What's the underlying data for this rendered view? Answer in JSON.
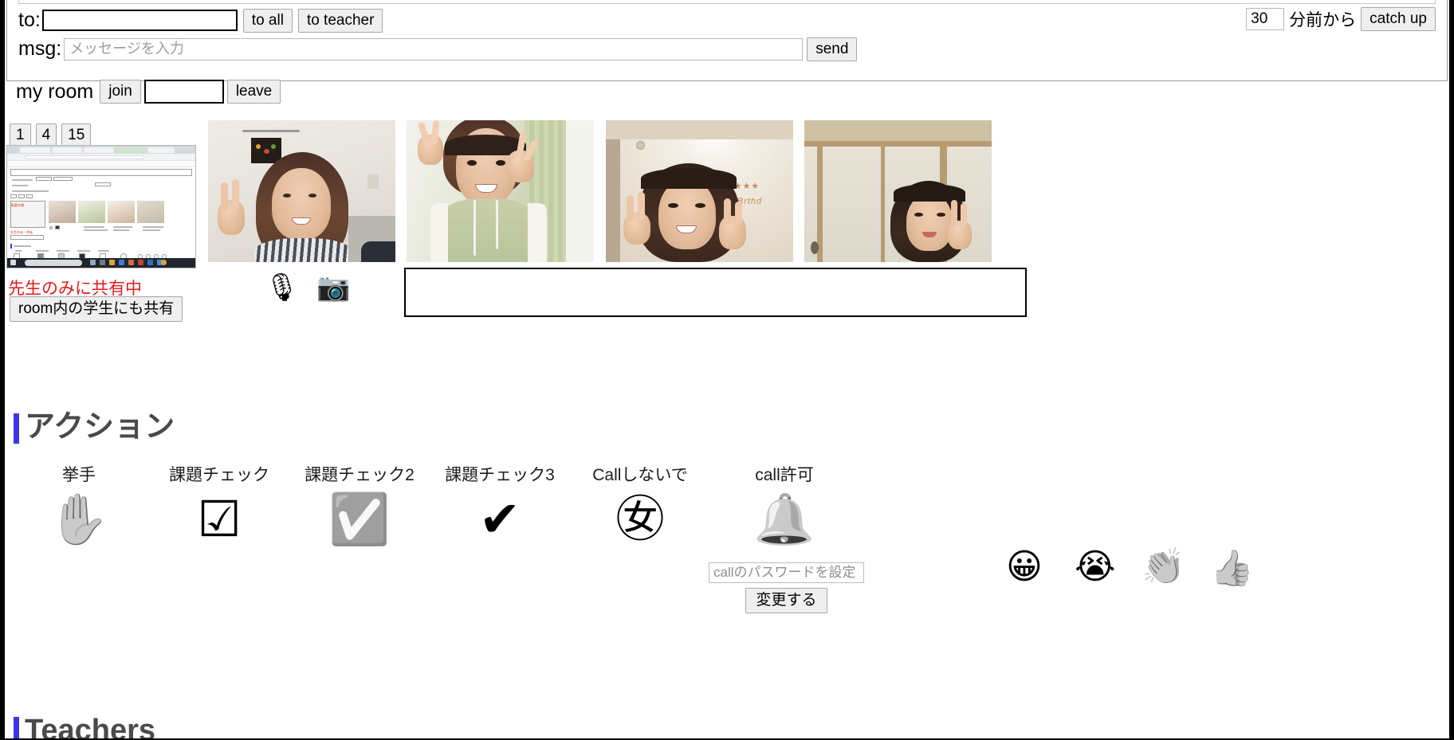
{
  "chat": {
    "history_value": "",
    "to_label": "to:",
    "to_value": "",
    "to_all_button": "to all",
    "to_teacher_button": "to teacher",
    "msg_label": "msg:",
    "msg_value": "",
    "msg_placeholder": "メッセージを入力",
    "send_button": "send",
    "catchup_minutes": "30",
    "catchup_unit_label": "分前から",
    "catchup_button": "catch up"
  },
  "room": {
    "title": "my room",
    "join_button": "join",
    "room_value": "",
    "leave_button": "leave",
    "layout_buttons": [
      "1",
      "4",
      "15"
    ]
  },
  "share": {
    "status_text": "先生のみに共有中",
    "share_button": "room内の学生にも共有",
    "mic_icon": "🎙",
    "camera_icon": "📷"
  },
  "videos": [
    {
      "name": "participant-1"
    },
    {
      "name": "participant-2"
    },
    {
      "name": "participant-3"
    },
    {
      "name": "participant-4"
    }
  ],
  "note_box": {
    "value": ""
  },
  "sections": {
    "action_heading": "アクション",
    "teachers_heading": "Teachers"
  },
  "actions": [
    {
      "label": "挙手",
      "icon": "✋",
      "name": "raise-hand"
    },
    {
      "label": "課題チェック",
      "icon": "☑",
      "name": "task-check-1"
    },
    {
      "label": "課題チェック2",
      "icon": "✅",
      "name": "task-check-2"
    },
    {
      "label": "課題チェック3",
      "icon": "✔",
      "name": "task-check-3"
    },
    {
      "label": "Callしないで",
      "icon": "㊛",
      "name": "do-not-call"
    },
    {
      "label": "call許可",
      "icon": "🔔",
      "name": "allow-call"
    }
  ],
  "reactions": [
    {
      "icon": "😀",
      "name": "smile-reaction"
    },
    {
      "icon": "😭",
      "name": "cry-reaction"
    },
    {
      "icon": "👏",
      "name": "clap-reaction"
    },
    {
      "icon": "👍",
      "name": "thumbs-up-reaction"
    }
  ],
  "call_password": {
    "value": "",
    "placeholder": "callのパスワードを設定",
    "change_button": "変更する"
  },
  "colors": {
    "accent": "#3b36e8",
    "warning": "#e41b1b",
    "heading": "#4a4a4a"
  }
}
